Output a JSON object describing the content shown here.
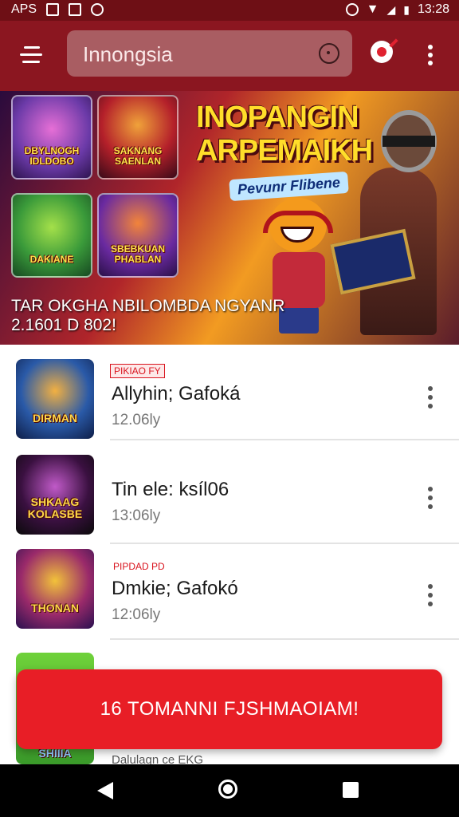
{
  "status_bar": {
    "carrier": "APS",
    "time": "13:28"
  },
  "search": {
    "value": "Innongsia"
  },
  "banner": {
    "title": "INOPANGIN ARPEMAIKH",
    "subtitle": "Pevunr Flibene",
    "caption_line1": "TAR OKGHA NBILOMBDA NGYANR",
    "caption_line2": "2.1601 D 802!",
    "tiles": [
      {
        "label": "DBYLNOGH IDLDOBO"
      },
      {
        "label": "SAKNANG SAENLAN"
      },
      {
        "label": "DAKIANE"
      },
      {
        "label": "SBEBKUAN PHABLAN"
      }
    ]
  },
  "list": [
    {
      "tag": "PIKIAO FY",
      "title": "Allyhin; Gafoká",
      "meta": "12.06ly",
      "thumb_label": "DIRMAN"
    },
    {
      "tag": "",
      "title": "Tin ele: ksíl06",
      "meta": "13:06ly",
      "thumb_label": "SHKAAG KOLASBE"
    },
    {
      "tag": "PIPDAD PD",
      "title": "Dmkie; Gafokó",
      "meta": "12:06ly",
      "thumb_label": "THONAN"
    },
    {
      "tag": "",
      "title": "Dalulagn ce EKG",
      "meta": "",
      "thumb_label": "SHIIIA"
    }
  ],
  "toast": {
    "text": "16 TOMANNI FJSHMAOIAM!"
  },
  "colors": {
    "app_bar": "#8b1620",
    "status_bar": "#6e0f15",
    "accent": "#e81e26"
  }
}
